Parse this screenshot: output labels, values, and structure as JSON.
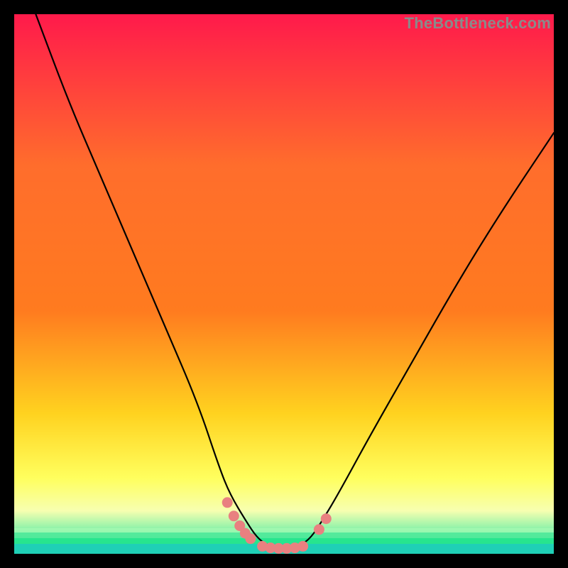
{
  "watermark": "TheBottleneck.com",
  "colors": {
    "top": "#ff1a4b",
    "mid1": "#ff7b1f",
    "mid2": "#ffd21f",
    "mid3": "#ffff5e",
    "mid4": "#f7ffb0",
    "bottom_green": "#27e58e",
    "bottom_teal": "#1fd0b6",
    "curve": "#000000",
    "marker_fill": "#e98080",
    "marker_stroke": "#e98080"
  },
  "chart_data": {
    "type": "line",
    "title": "",
    "xlabel": "",
    "ylabel": "",
    "xlim": [
      0,
      100
    ],
    "ylim": [
      0,
      100
    ],
    "grid": false,
    "legend": null,
    "note": "Values are read off the plotted curve in percent of plot width (x) and percent of plot height (y, 0 = bottom).",
    "series": [
      {
        "name": "bottleneck-curve",
        "x": [
          4,
          10,
          16,
          22,
          28,
          34,
          38,
          40,
          43,
          45,
          47,
          50,
          53,
          55,
          57,
          60,
          66,
          74,
          82,
          90,
          100
        ],
        "y": [
          100,
          84,
          70,
          56,
          42,
          28,
          16,
          11,
          6,
          3,
          1.5,
          1,
          1.5,
          3,
          6,
          11,
          22,
          36,
          50,
          63,
          78
        ]
      }
    ],
    "markers": [
      {
        "name": "left-cluster-top",
        "x": 39.5,
        "y": 9.5
      },
      {
        "name": "left-cluster-upper",
        "x": 40.7,
        "y": 7.0
      },
      {
        "name": "left-cluster-mid",
        "x": 41.8,
        "y": 5.2
      },
      {
        "name": "left-cluster-low",
        "x": 42.8,
        "y": 3.8
      },
      {
        "name": "left-cluster-bottom",
        "x": 43.8,
        "y": 2.8
      },
      {
        "name": "flat-1",
        "x": 46.0,
        "y": 1.4
      },
      {
        "name": "flat-2",
        "x": 47.5,
        "y": 1.1
      },
      {
        "name": "flat-3",
        "x": 49.0,
        "y": 1.0
      },
      {
        "name": "flat-4",
        "x": 50.5,
        "y": 1.0
      },
      {
        "name": "flat-5",
        "x": 52.0,
        "y": 1.1
      },
      {
        "name": "flat-6",
        "x": 53.5,
        "y": 1.4
      },
      {
        "name": "right-pair-low",
        "x": 56.5,
        "y": 4.5
      },
      {
        "name": "right-pair-high",
        "x": 57.8,
        "y": 6.5
      }
    ]
  }
}
